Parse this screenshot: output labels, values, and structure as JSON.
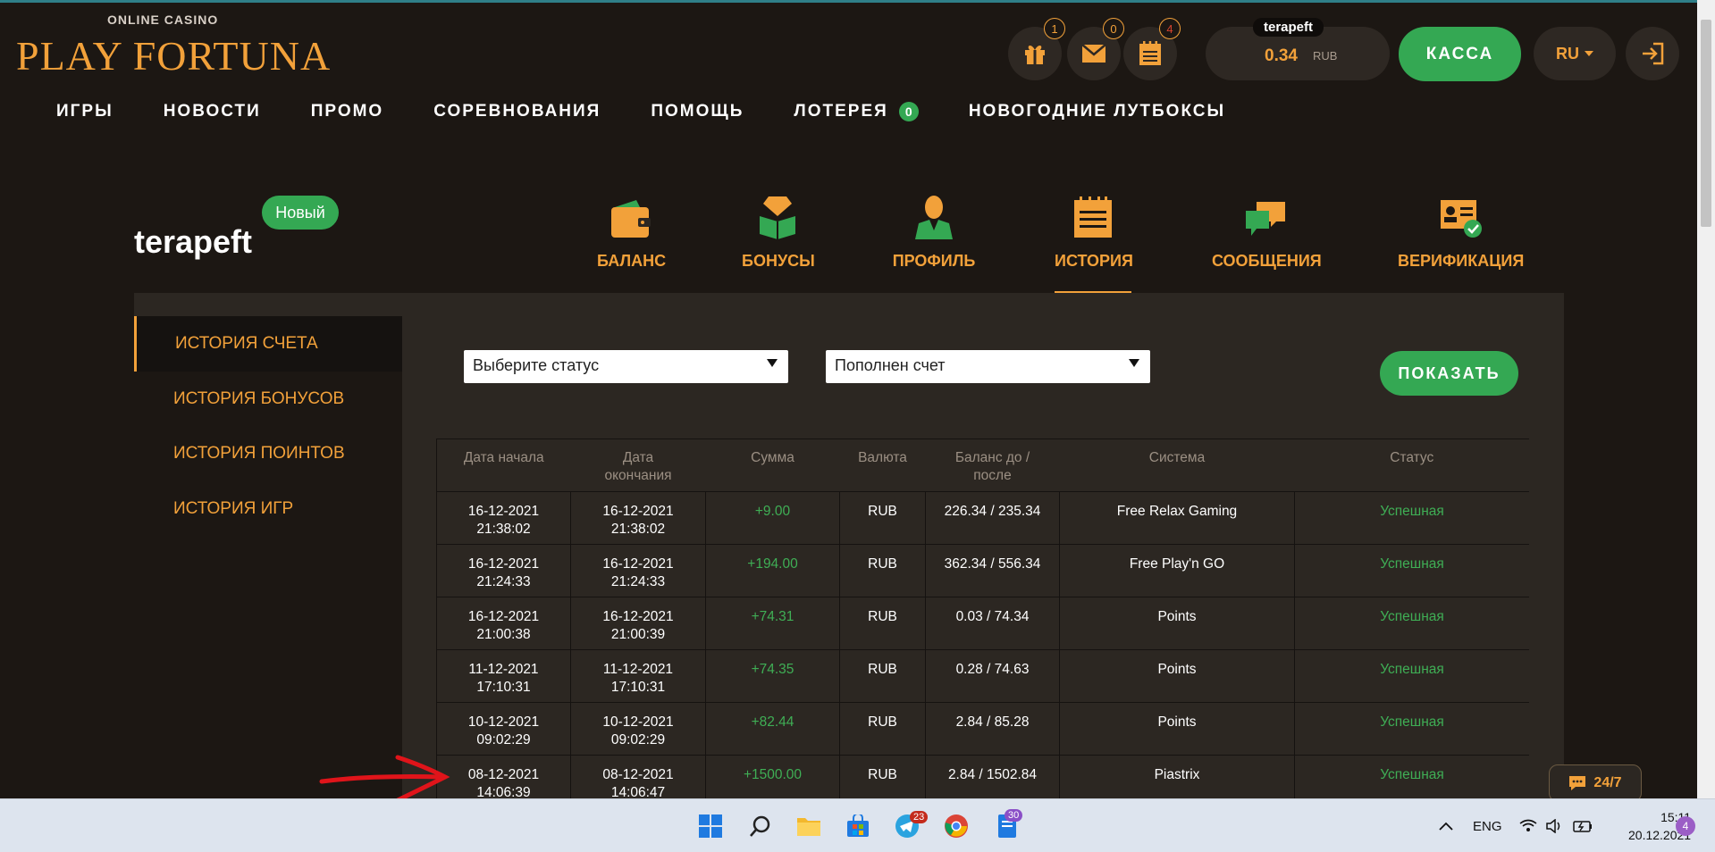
{
  "logo": {
    "sub": "ONLINE CASINO",
    "main": "PLAY FORTUNA"
  },
  "header": {
    "gift_count": "1",
    "mail_count": "0",
    "tasks_count": "4",
    "username": "terapeft",
    "balance": "0.34",
    "currency": "RUB",
    "kassa_label": "КАССА",
    "lang": "RU"
  },
  "nav": {
    "items": [
      "ИГРЫ",
      "НОВОСТИ",
      "ПРОМО",
      "СОРЕВНОВАНИЯ",
      "ПОМОЩЬ",
      "ЛОТЕРЕЯ",
      "НОВОГОДНИЕ ЛУТБОКСЫ"
    ],
    "lottery_count": "0"
  },
  "profile": {
    "username": "terapeft",
    "badge": "Новый",
    "tabs": [
      "БАЛАНС",
      "БОНУСЫ",
      "ПРОФИЛЬ",
      "ИСТОРИЯ",
      "СООБЩЕНИЯ",
      "ВЕРИФИКАЦИЯ"
    ],
    "active_tab": "ИСТОРИЯ"
  },
  "sidebar": {
    "items": [
      "ИСТОРИЯ СЧЕТА",
      "ИСТОРИЯ БОНУСОВ",
      "ИСТОРИЯ ПОИНТОВ",
      "ИСТОРИЯ ИГР"
    ],
    "active": "ИСТОРИЯ СЧЕТА"
  },
  "filters": {
    "status_value": "Выберите статус",
    "type_value": "Пополнен счет",
    "show_label": "ПОКАЗАТЬ"
  },
  "table": {
    "headers": [
      "Дата начала",
      "Дата\nокончания",
      "Сумма",
      "Валюта",
      "Баланс до /\nпосле",
      "Система",
      "Статус"
    ],
    "rows": [
      {
        "start_date": "16-12-2021",
        "start_time": "21:38:02",
        "end_date": "16-12-2021",
        "end_time": "21:38:02",
        "amount": "+9.00",
        "currency": "RUB",
        "balance": "226.34 / 235.34",
        "system": "Free Relax Gaming",
        "status": "Успешная"
      },
      {
        "start_date": "16-12-2021",
        "start_time": "21:24:33",
        "end_date": "16-12-2021",
        "end_time": "21:24:33",
        "amount": "+194.00",
        "currency": "RUB",
        "balance": "362.34 / 556.34",
        "system": "Free Play'n GO",
        "status": "Успешная"
      },
      {
        "start_date": "16-12-2021",
        "start_time": "21:00:38",
        "end_date": "16-12-2021",
        "end_time": "21:00:39",
        "amount": "+74.31",
        "currency": "RUB",
        "balance": "0.03 / 74.34",
        "system": "Points",
        "status": "Успешная"
      },
      {
        "start_date": "11-12-2021",
        "start_time": "17:10:31",
        "end_date": "11-12-2021",
        "end_time": "17:10:31",
        "amount": "+74.35",
        "currency": "RUB",
        "balance": "0.28 / 74.63",
        "system": "Points",
        "status": "Успешная"
      },
      {
        "start_date": "10-12-2021",
        "start_time": "09:02:29",
        "end_date": "10-12-2021",
        "end_time": "09:02:29",
        "amount": "+82.44",
        "currency": "RUB",
        "balance": "2.84 / 85.28",
        "system": "Points",
        "status": "Успешная"
      },
      {
        "start_date": "08-12-2021",
        "start_time": "14:06:39",
        "end_date": "08-12-2021",
        "end_time": "14:06:47",
        "amount": "+1500.00",
        "currency": "RUB",
        "balance": "2.84 / 1502.84",
        "system": "Piastrix",
        "status": "Успешная"
      }
    ]
  },
  "chat": {
    "label": "24/7"
  },
  "taskbar": {
    "telegram_badge": "23",
    "app_badge": "30",
    "lang": "ENG",
    "time": "15:11",
    "date": "20.12.2021",
    "notifications": "4"
  },
  "colors": {
    "accent": "#f2a13a",
    "green": "#34a853",
    "bg": "#1c1713",
    "panel": "#2c2722"
  }
}
